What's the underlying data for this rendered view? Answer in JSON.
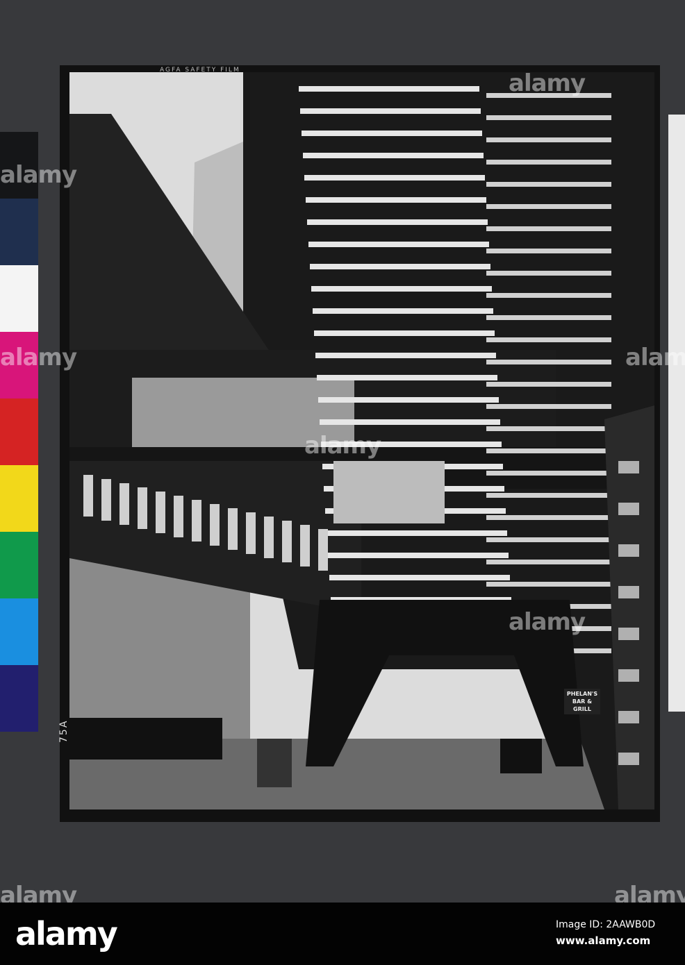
{
  "photo": {
    "film_edge_text": "AGFA SAFETY FILM",
    "negative_number": "75A",
    "sign_text": [
      "PHELAN'S",
      "BAR & GRILL"
    ]
  },
  "color_strip": [
    "#151618",
    "#1f2f4e",
    "#f4f4f4",
    "#d8157a",
    "#d52323",
    "#f2d81a",
    "#109a4b",
    "#1a8fe0",
    "#221f6e"
  ],
  "watermark": {
    "text": "alamy"
  },
  "footer": {
    "logo": "alamy",
    "image_id": "Image ID: 2AAWB0D",
    "website": "www.alamy.com"
  }
}
